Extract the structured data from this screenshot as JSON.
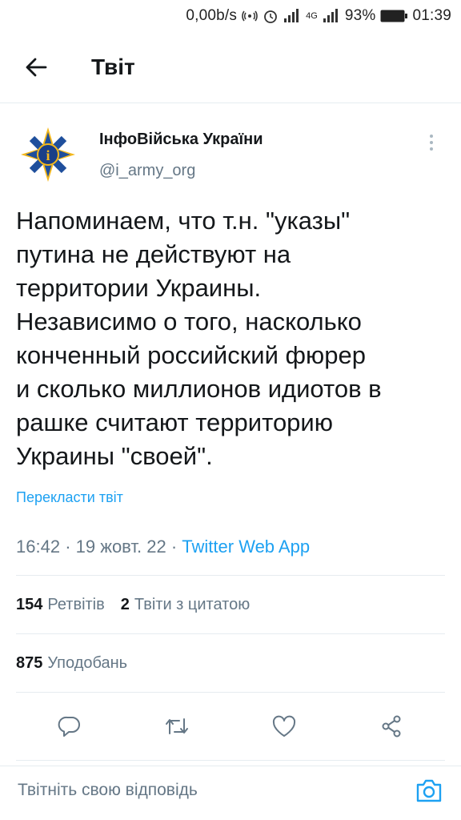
{
  "status_bar": {
    "speed": "0,00b/s",
    "network_label": "4G",
    "battery": "93%",
    "time": "01:39",
    "icons": [
      "hotspot-icon",
      "alarm-icon",
      "signal-icon",
      "battery-icon"
    ]
  },
  "header": {
    "title": "Твіт",
    "back_icon": "arrow-left-icon"
  },
  "tweet": {
    "author_name": "ІнфоВійська України",
    "author_handle": "@i_army_org",
    "text": "Напоминаем, что т.н. \"указы\"\nпутина не действуют на\nтерритории Украины.\nНезависимо о того, насколько\nконченный российский фюрер\nи сколько миллионов идиотов в\nрашке считают территорию\nУкраины \"своей\".",
    "translate_label": "Перекласти твіт",
    "time": "16:42",
    "date": "19 жовт. 22",
    "source": "Twitter Web App",
    "retweets_count": "154",
    "retweets_label": "Ретвітів",
    "quotes_count": "2",
    "quotes_label": "Твіти з цитатою",
    "likes_count": "875",
    "likes_label": "Уподобань"
  },
  "actions": [
    "reply-icon",
    "retweet-icon",
    "like-icon",
    "share-icon"
  ],
  "reply": {
    "placeholder": "Твітніть свою відповідь"
  },
  "colors": {
    "accent": "#1da1f2",
    "text": "#14171a",
    "secondary": "#657786",
    "divider": "#e6ecf0"
  }
}
